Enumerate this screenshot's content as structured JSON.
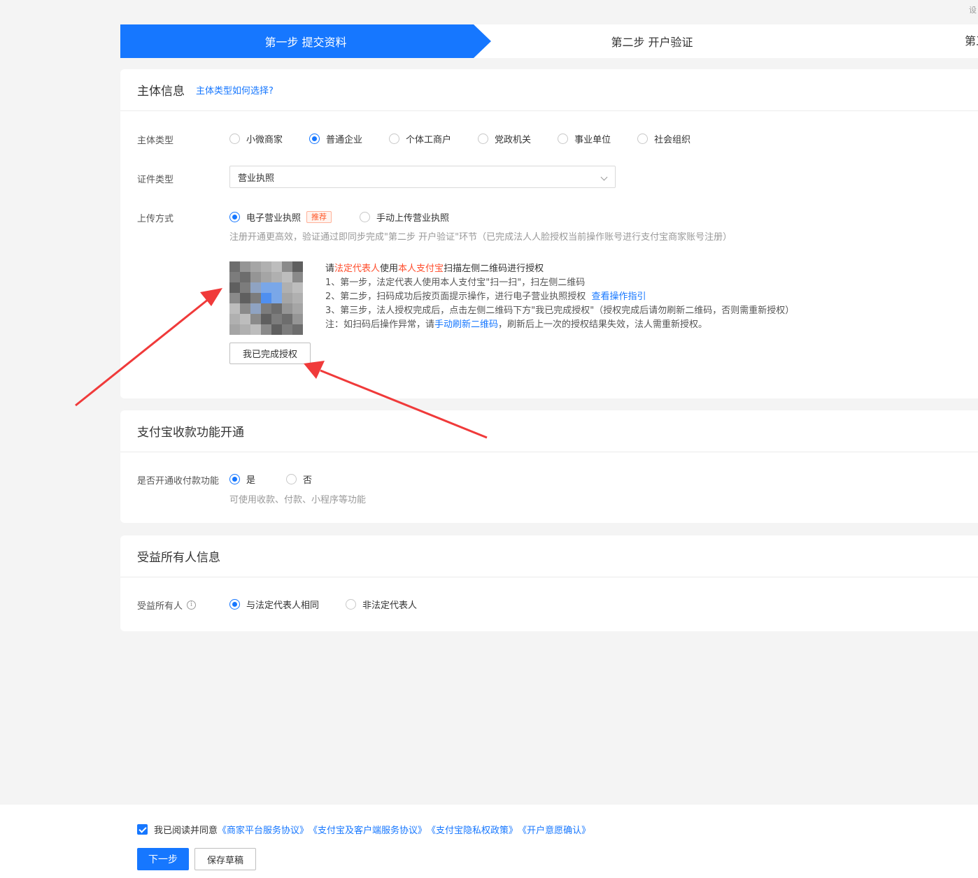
{
  "steps": {
    "step1": "第一步 提交资料",
    "step2": "第二步 开户验证",
    "step3": "第三"
  },
  "top_corner": "设",
  "subject": {
    "title": "主体信息",
    "help_link": "主体类型如何选择?",
    "type_label": "主体类型",
    "types": [
      "小微商家",
      "普通企业",
      "个体工商户",
      "党政机关",
      "事业单位",
      "社会组织"
    ],
    "selected_type": "普通企业",
    "cert_label": "证件类型",
    "cert_value": "营业执照",
    "upload_label": "上传方式",
    "upload_opt1": "电子营业执照",
    "upload_badge": "推荐",
    "upload_opt2": "手动上传营业执照",
    "upload_hint": "注册开通更高效，验证通过即同步完成\"第二步 开户验证\"环节（已完成法人人脸授权当前操作账号进行支付宝商家账号注册）",
    "instr_title_p1": "请",
    "instr_title_hl1": "法定代表人",
    "instr_title_p2": "使用",
    "instr_title_hl2": "本人支付宝",
    "instr_title_p3": "扫描左侧二维码进行授权",
    "instr_line1": "1、第一步，法定代表人使用本人支付宝\"扫一扫\"，扫左侧二维码",
    "instr_line2": "2、第二步，扫码成功后按页面提示操作，进行电子营业执照授权",
    "instr_line2_link": "查看操作指引",
    "instr_line3": "3、第三步，法人授权完成后，点击左侧二维码下方\"我已完成授权\"（授权完成后请勿刷新二维码，否则需重新授权）",
    "instr_note_p1": "注：如扫码后操作异常，请",
    "instr_note_link": "手动刷新二维码",
    "instr_note_p2": "，刷新后上一次的授权结果失效，法人需重新授权。",
    "done_button": "我已完成授权"
  },
  "alipay": {
    "title": "支付宝收款功能开通",
    "label": "是否开通收付款功能",
    "yes": "是",
    "no": "否",
    "hint": "可使用收款、付款、小程序等功能"
  },
  "beneficiary": {
    "title": "受益所有人信息",
    "label": "受益所有人",
    "opt1": "与法定代表人相同",
    "opt2": "非法定代表人"
  },
  "footer": {
    "agree_text": "我已阅读并同意",
    "links": [
      "《商家平台服务协议》",
      "《支付宝及客户端服务协议》",
      "《支付宝隐私权政策》",
      "《开户意愿确认》"
    ],
    "next_button": "下一步",
    "draft_button": "保存草稿"
  },
  "colors": {
    "primary": "#1677ff",
    "highlight": "#ff4d2c",
    "annotation_arrow": "#f03a3a"
  }
}
